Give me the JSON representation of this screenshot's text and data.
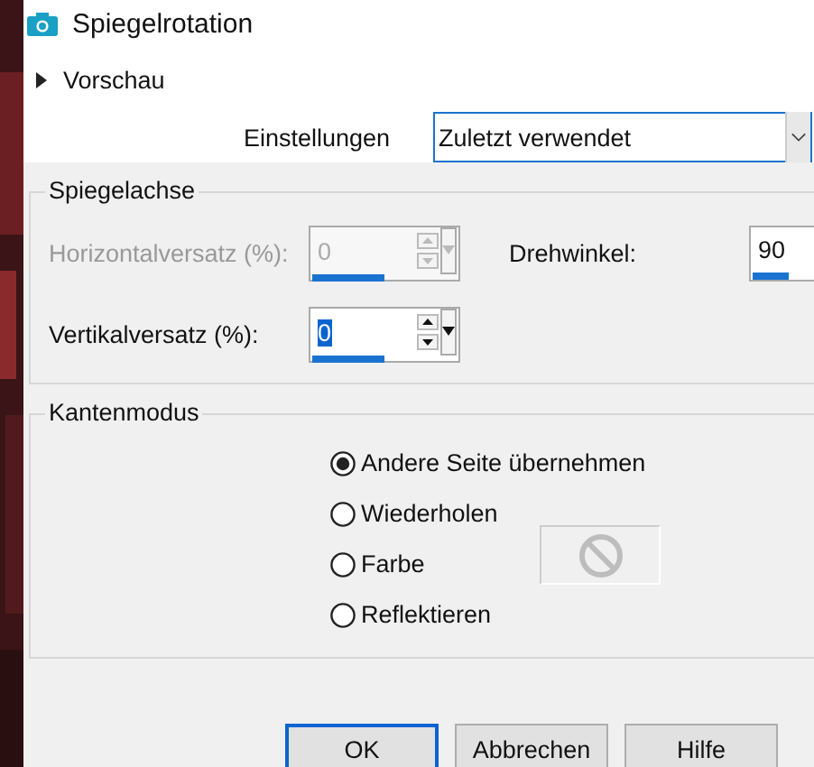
{
  "window": {
    "title": "Spiegelrotation"
  },
  "preview": {
    "label": "Vorschau",
    "expanded": false
  },
  "settings": {
    "label": "Einstellungen",
    "value": "Zuletzt verwendet"
  },
  "mirror_axis": {
    "title": "Spiegelachse",
    "fields": [
      {
        "kind": "spin",
        "label": "Horizontalversatz (%):",
        "value": "0",
        "disabled": true,
        "selected": false,
        "level": 0.5
      },
      {
        "kind": "number",
        "label": "Drehwinkel:",
        "value": "90",
        "disabled": false,
        "selected": false,
        "level": 0.25
      },
      {
        "kind": "spin",
        "label": "Vertikalversatz (%):",
        "value": "0",
        "disabled": false,
        "selected": true,
        "level": 0.5
      }
    ]
  },
  "edge_mode": {
    "title": "Kantenmodus",
    "options": [
      {
        "label": "Andere Seite übernehmen",
        "selected": true
      },
      {
        "label": "Wiederholen",
        "selected": false
      },
      {
        "label": "Farbe",
        "selected": false,
        "kind": "color"
      },
      {
        "label": "Reflektieren",
        "selected": false
      }
    ]
  },
  "buttons": [
    {
      "label": "OK",
      "default": true
    },
    {
      "label": "Abbrechen",
      "default": false
    },
    {
      "label": "Hilfe",
      "default": false
    }
  ]
}
